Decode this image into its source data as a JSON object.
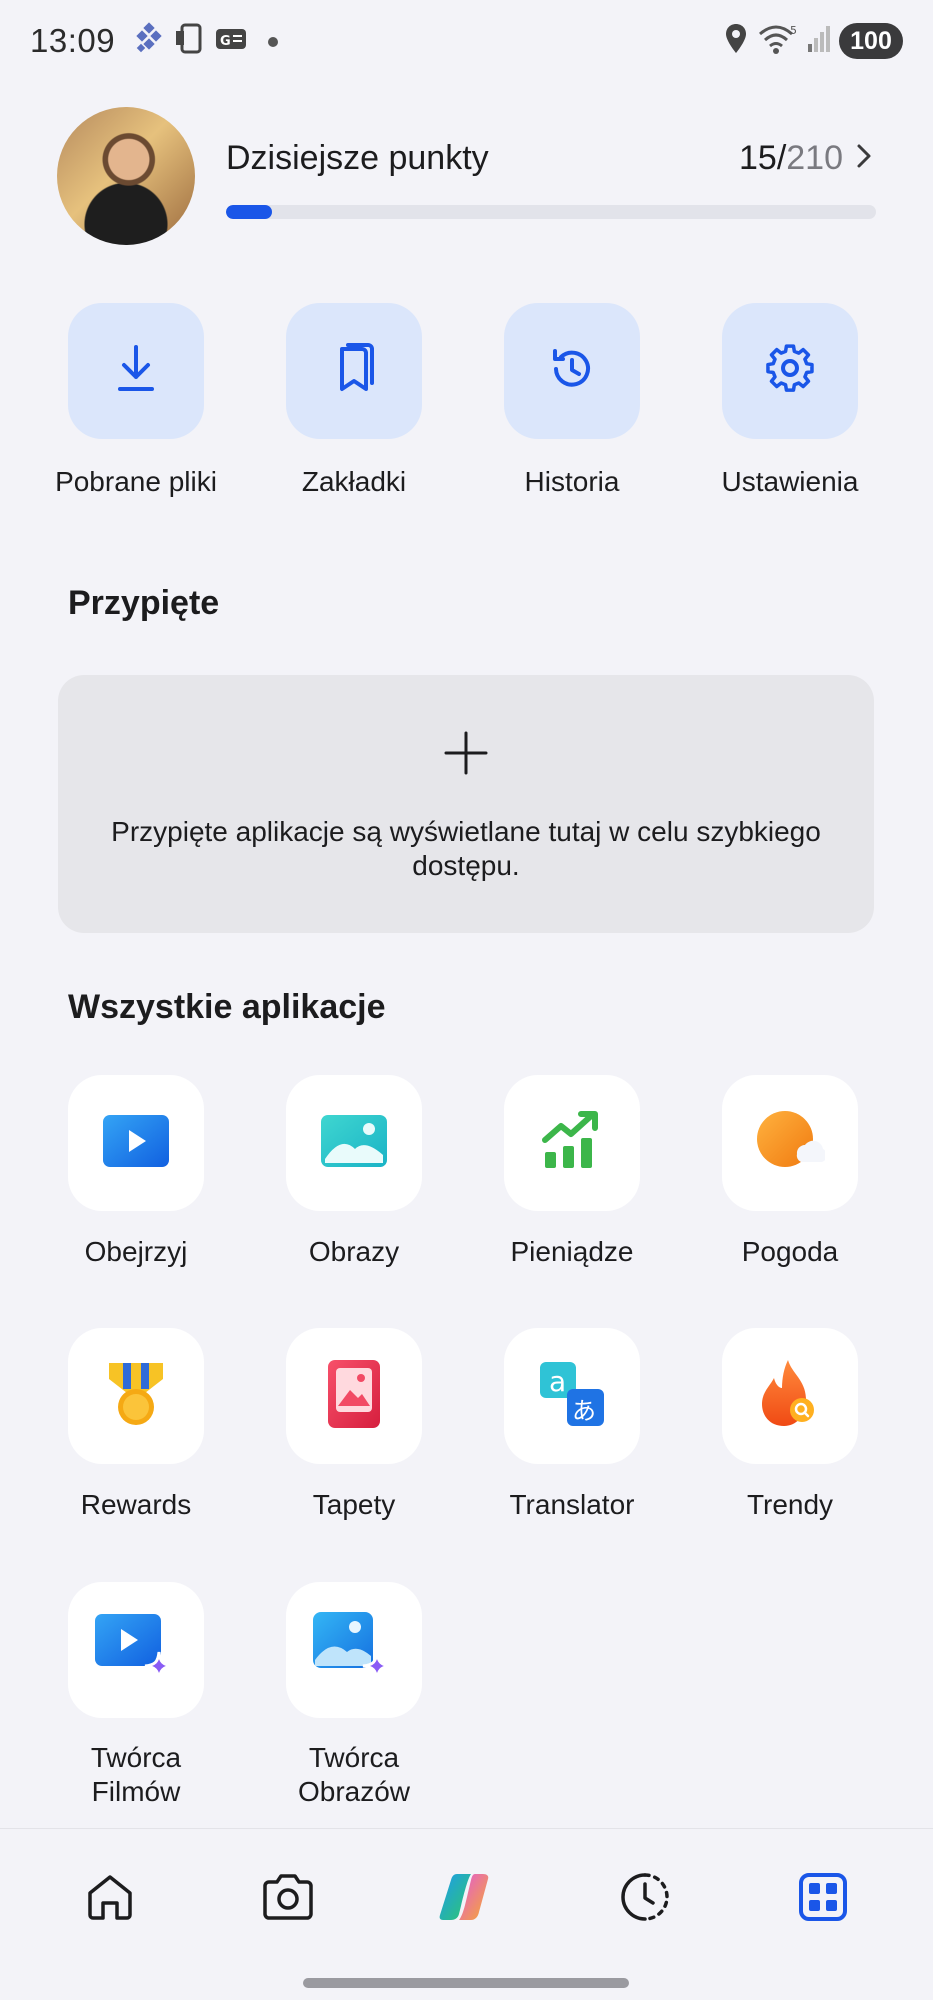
{
  "status_bar": {
    "time": "13:09",
    "battery": "100"
  },
  "profile": {
    "points_label": "Dzisiejsze punkty",
    "points_current": "15/",
    "points_total": "210",
    "progress_fraction": 0.071
  },
  "quick_actions": [
    {
      "label": "Pobrane pliki",
      "icon": "download-icon"
    },
    {
      "label": "Zakładki",
      "icon": "bookmarks-icon"
    },
    {
      "label": "Historia",
      "icon": "history-icon"
    },
    {
      "label": "Ustawienia",
      "icon": "settings-gear-icon"
    }
  ],
  "pinned": {
    "title": "Przypięte",
    "empty_text": "Przypięte aplikacje są wyświetlane tutaj w celu szybkiego dostępu."
  },
  "all_apps": {
    "title": "Wszystkie aplikacje",
    "items": [
      {
        "label": "Obejrzyj",
        "icon": "watch-play-icon"
      },
      {
        "label": "Obrazy",
        "icon": "images-icon"
      },
      {
        "label": "Pieniądze",
        "icon": "money-chart-icon"
      },
      {
        "label": "Pogoda",
        "icon": "weather-icon"
      },
      {
        "label": "Rewards",
        "icon": "rewards-medal-icon"
      },
      {
        "label": "Tapety",
        "icon": "wallpapers-icon"
      },
      {
        "label": "Translator",
        "icon": "translator-icon"
      },
      {
        "label": "Trendy",
        "icon": "trending-flame-icon"
      },
      {
        "label": "Twórca Filmów",
        "line1": "Twórca",
        "line2": "Filmów",
        "icon": "video-creator-icon"
      },
      {
        "label": "Twórca Obrazów",
        "line1": "Twórca",
        "line2": "Obrazów",
        "icon": "image-creator-icon"
      }
    ]
  },
  "bottom_nav": [
    {
      "icon": "home-icon"
    },
    {
      "icon": "camera-icon"
    },
    {
      "icon": "copilot-icon"
    },
    {
      "icon": "recent-clock-icon"
    },
    {
      "icon": "apps-grid-icon",
      "active": true
    }
  ],
  "colors": {
    "accent": "#1a56e8",
    "tile_blue": "#dbe6fb",
    "background": "#f3f3f8"
  }
}
